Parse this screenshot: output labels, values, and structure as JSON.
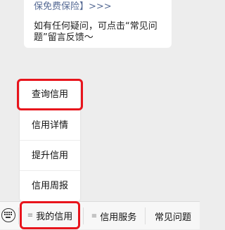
{
  "bubble": {
    "link_text": "保免费保险】>>>",
    "message": "如有任何疑问，可点击“常见问题”留言反馈～"
  },
  "popup_menu": {
    "items": [
      {
        "label": "查询信用"
      },
      {
        "label": "信用详情"
      },
      {
        "label": "提升信用"
      },
      {
        "label": "信用周报"
      }
    ]
  },
  "bottom_menu": {
    "lines_glyph": "≡",
    "items": [
      {
        "label": "我的信用"
      },
      {
        "label": "信用服务"
      },
      {
        "label": "常见问题"
      }
    ]
  },
  "colors": {
    "highlight": "#e8141c",
    "link": "#576b95",
    "background": "#ededed"
  }
}
